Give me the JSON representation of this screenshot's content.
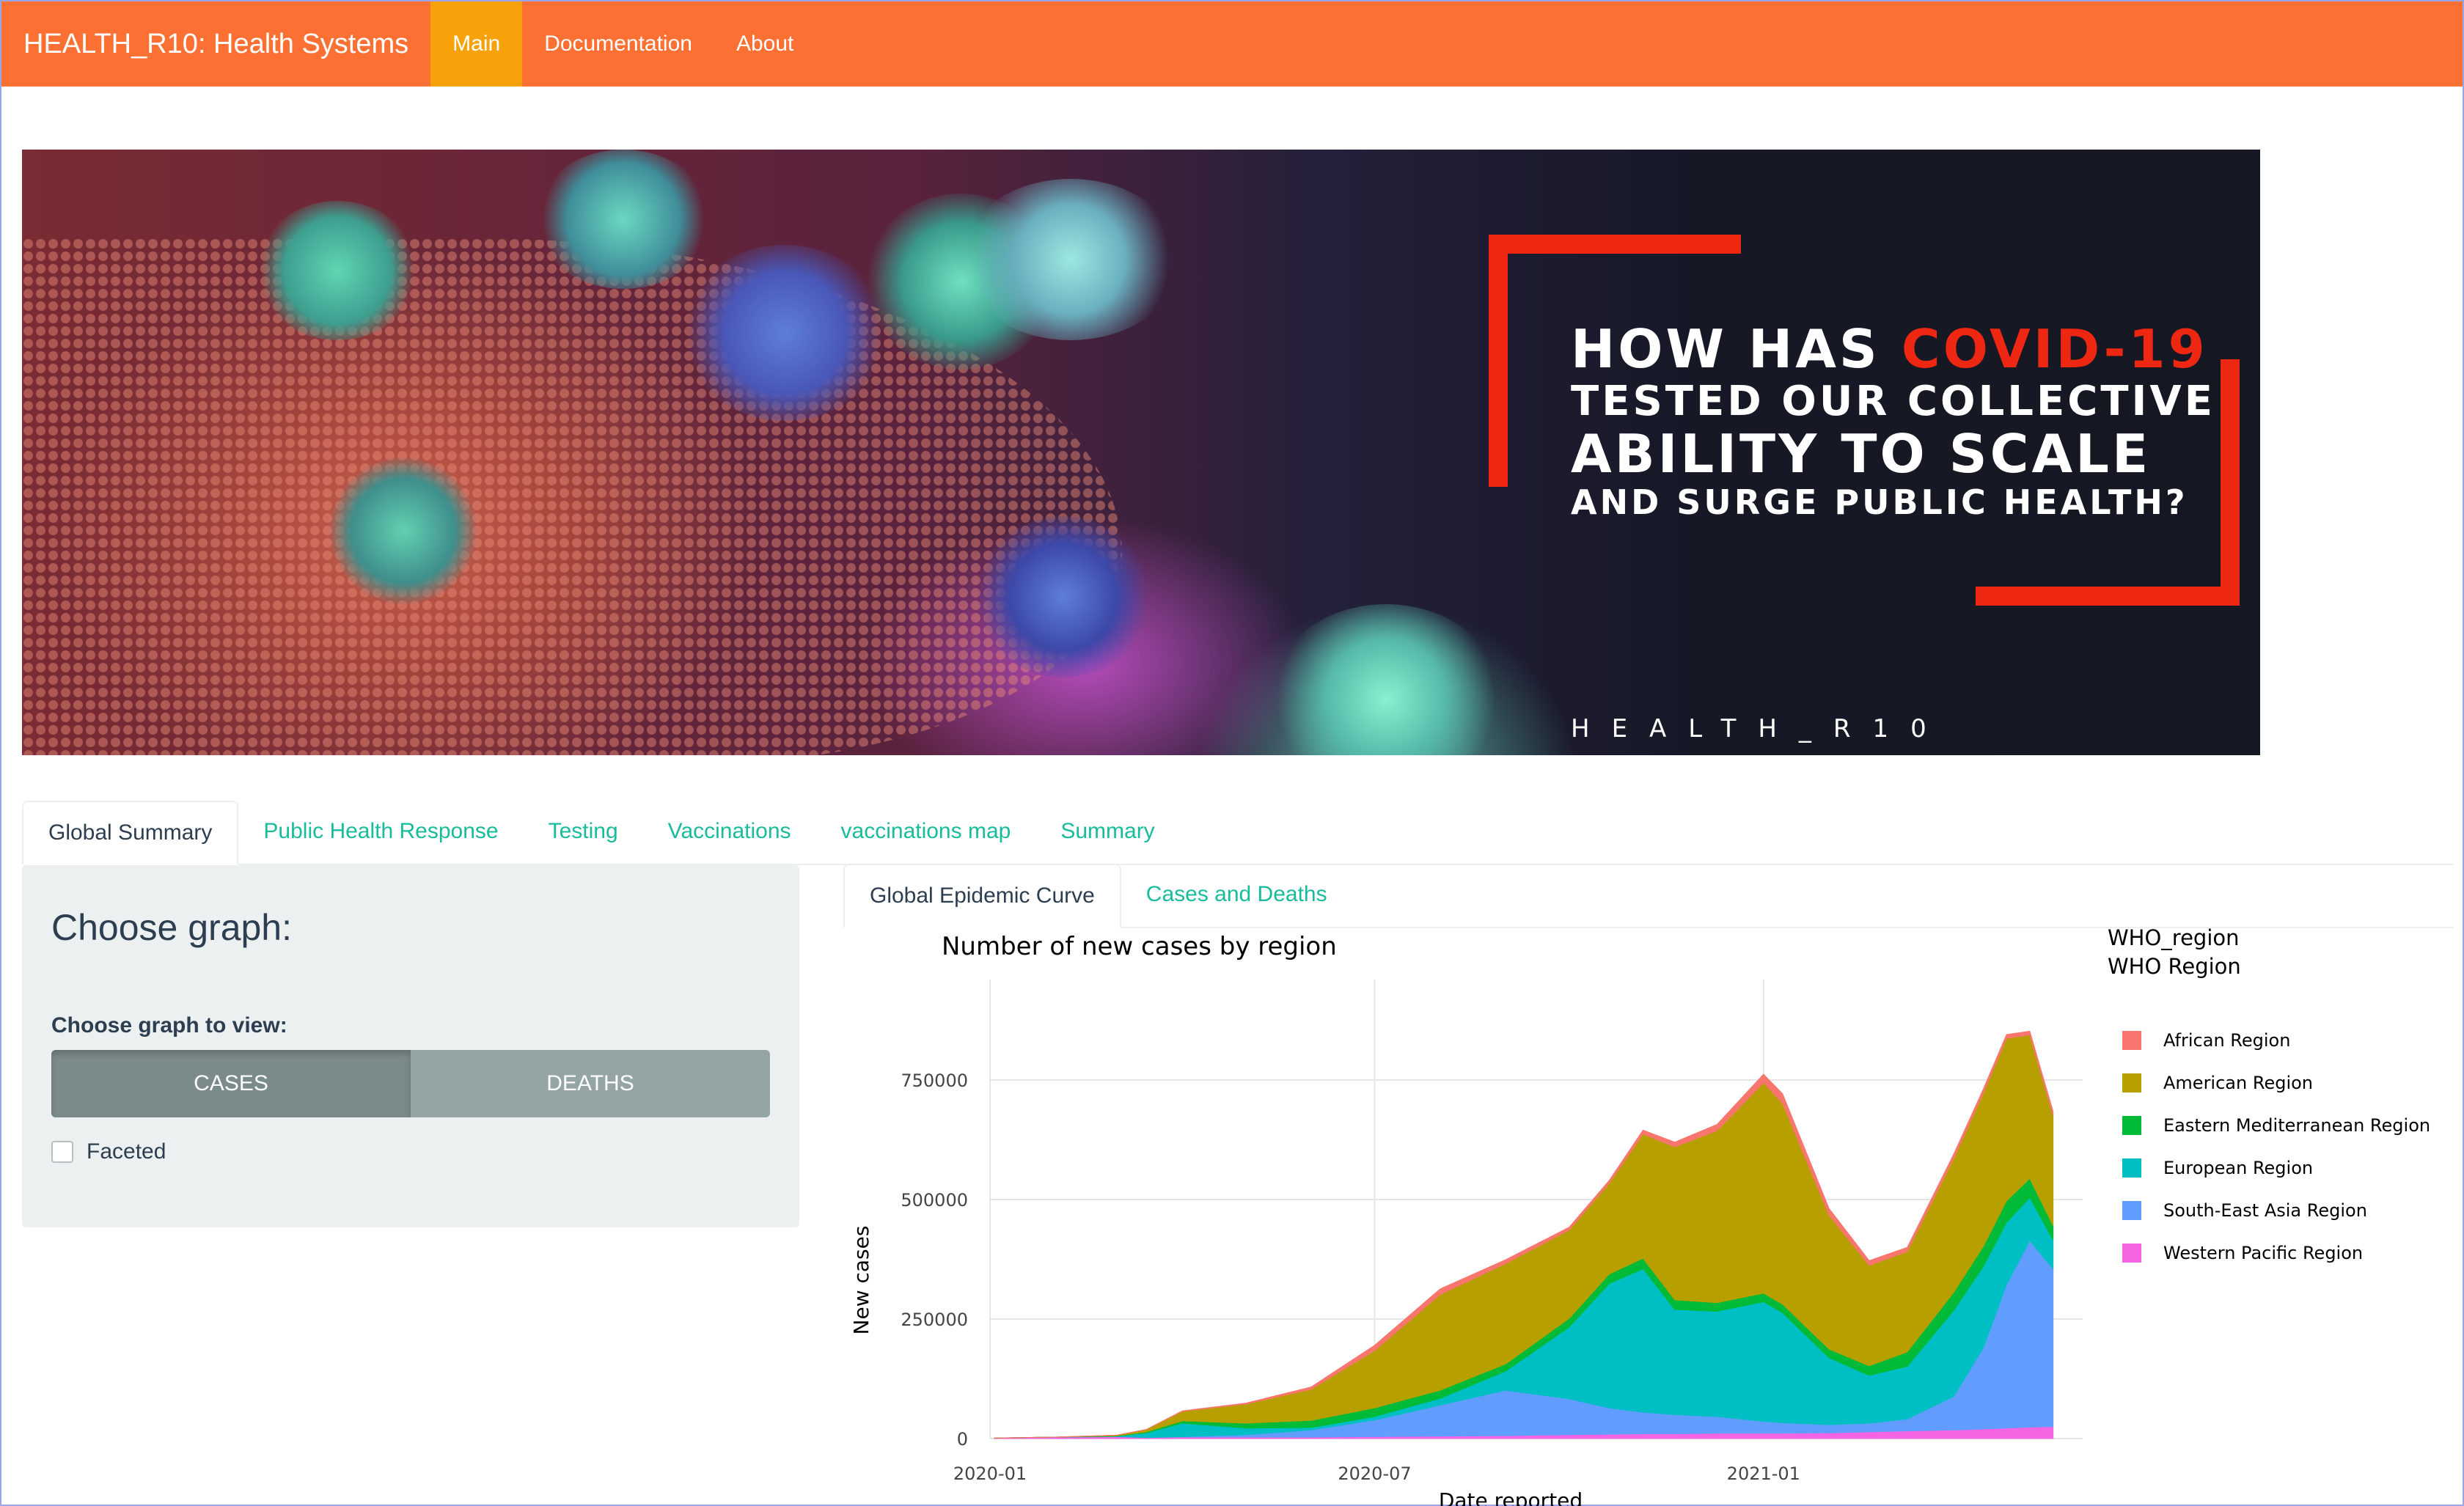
{
  "navbar": {
    "brand": "HEALTH_R10: Health Systems",
    "items": [
      {
        "label": "Main",
        "active": true
      },
      {
        "label": "Documentation",
        "active": false
      },
      {
        "label": "About",
        "active": false
      }
    ],
    "colors": {
      "bar": "#fd7033",
      "active": "#f8a20b"
    }
  },
  "banner": {
    "line1_prefix": "HOW HAS ",
    "line1_accent": "COVID-19",
    "line2": "TESTED OUR COLLECTIVE",
    "line3": "ABILITY TO SCALE",
    "line4": "AND SURGE PUBLIC HEALTH?",
    "subtitle": "HEALTH_R10",
    "accent_color": "#ee2713"
  },
  "tabs": [
    {
      "label": "Global Summary",
      "active": true
    },
    {
      "label": "Public Health Response",
      "active": false
    },
    {
      "label": "Testing",
      "active": false
    },
    {
      "label": "Vaccinations",
      "active": false
    },
    {
      "label": "vaccinations map",
      "active": false
    },
    {
      "label": "Summary",
      "active": false
    }
  ],
  "sidebar": {
    "title": "Choose graph:",
    "label": "Choose graph to view:",
    "buttons": [
      {
        "label": "CASES",
        "active": true
      },
      {
        "label": "DEATHS",
        "active": false
      }
    ],
    "checkbox": {
      "label": "Faceted",
      "checked": false
    }
  },
  "subtabs": [
    {
      "label": "Global Epidemic Curve",
      "active": true
    },
    {
      "label": "Cases and Deaths",
      "active": false
    }
  ],
  "chart_data": {
    "type": "area",
    "stacked": true,
    "title": "Number of new cases by region",
    "xlabel": "Date reported",
    "ylabel": "New cases",
    "x_ticks": [
      "2020-01",
      "2020-07",
      "2021-01"
    ],
    "y_ticks": [
      0,
      250000,
      500000,
      750000
    ],
    "ylim": [
      0,
      960000
    ],
    "legend_title_line1": "WHO_region",
    "legend_title_line2": "WHO Region",
    "legend_position": "right",
    "grid": true,
    "x": [
      "2020-01-03",
      "2020-02-01",
      "2020-03-01",
      "2020-03-15",
      "2020-04-01",
      "2020-05-01",
      "2020-06-01",
      "2020-07-01",
      "2020-08-01",
      "2020-09-01",
      "2020-10-01",
      "2020-10-20",
      "2020-11-05",
      "2020-11-20",
      "2020-12-10",
      "2021-01-01",
      "2021-01-10",
      "2021-02-01",
      "2021-02-20",
      "2021-03-10",
      "2021-04-01",
      "2021-04-15",
      "2021-04-26",
      "2021-05-07",
      "2021-05-18"
    ],
    "series": [
      {
        "name": "Western Pacific Region",
        "color": "#f564e3",
        "values": [
          1000,
          3000,
          4000,
          2000,
          3000,
          3000,
          3000,
          4000,
          5000,
          6000,
          8000,
          9000,
          10000,
          10000,
          11000,
          11000,
          11000,
          12000,
          14000,
          16000,
          18000,
          20000,
          22000,
          24000,
          25000
        ]
      },
      {
        "name": "South-East Asia Region",
        "color": "#619cff",
        "values": [
          0,
          0,
          0,
          0,
          1000,
          5000,
          15000,
          35000,
          65000,
          95000,
          75000,
          55000,
          45000,
          40000,
          35000,
          25000,
          22000,
          17000,
          18000,
          25000,
          70000,
          170000,
          300000,
          390000,
          330000
        ]
      },
      {
        "name": "European Region",
        "color": "#00bfc4",
        "values": [
          0,
          0,
          1000,
          10000,
          28000,
          14000,
          5000,
          7000,
          14000,
          40000,
          150000,
          260000,
          300000,
          220000,
          220000,
          250000,
          230000,
          140000,
          100000,
          110000,
          180000,
          170000,
          130000,
          90000,
          60000
        ]
      },
      {
        "name": "Eastern Mediterranean Region",
        "color": "#00ba38",
        "values": [
          0,
          0,
          1000,
          2000,
          5000,
          10000,
          15000,
          18000,
          17000,
          15000,
          18000,
          20000,
          22000,
          20000,
          18000,
          18000,
          18000,
          18000,
          20000,
          30000,
          38000,
          42000,
          45000,
          40000,
          30000
        ]
      },
      {
        "name": "American Region",
        "color": "#b79f00",
        "values": [
          0,
          0,
          1000,
          5000,
          20000,
          40000,
          65000,
          120000,
          200000,
          210000,
          185000,
          190000,
          260000,
          320000,
          360000,
          440000,
          420000,
          280000,
          210000,
          210000,
          280000,
          320000,
          340000,
          300000,
          230000
        ]
      },
      {
        "name": "African Region",
        "color": "#f8766d",
        "values": [
          0,
          0,
          0,
          0,
          1000,
          2000,
          5000,
          11000,
          12000,
          8000,
          6000,
          6000,
          8000,
          10000,
          13000,
          18000,
          20000,
          14000,
          10000,
          9000,
          9000,
          9000,
          8000,
          8000,
          9000
        ]
      }
    ]
  }
}
